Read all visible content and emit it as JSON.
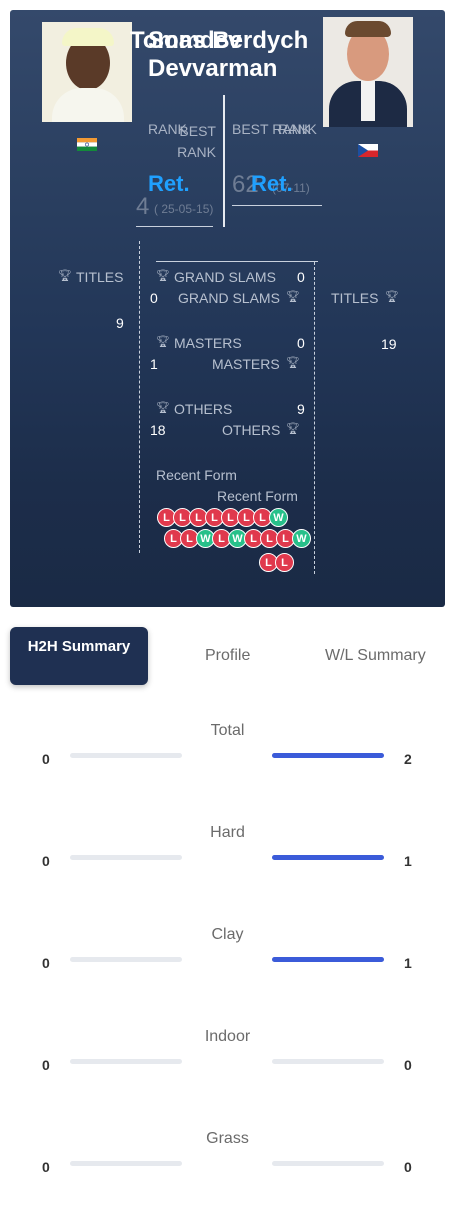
{
  "player1": {
    "name": "Somdev Devvarman",
    "country_flag": "india-flag-icon",
    "rank_label": "RANK",
    "rank_value": "Ret.",
    "best_rank_label": "BEST RANK",
    "best_rank_value": "4",
    "best_rank_date": "( 25-05-15)",
    "titles_label": "TITLES",
    "titles_value": "9",
    "grand_slams_label": "GRAND SLAMS",
    "grand_slams_value": "0",
    "masters_label": "MASTERS",
    "masters_value": "1",
    "others_label": "OTHERS",
    "others_value": "18",
    "recent_form_label": "Recent Form",
    "recent_form": [
      "L",
      "L",
      "L",
      "L",
      "L",
      "L",
      "L",
      "W"
    ]
  },
  "player2": {
    "name": "Tomas Berdych",
    "country_flag": "czech-flag-icon",
    "rank_label": "RANK",
    "rank_value": "Ret.",
    "best_rank_label": "BEST RANK",
    "best_rank_value": "62",
    "best_rank_date": "(07-11)",
    "titles_label": "TITLES",
    "titles_value": "19",
    "grand_slams_label": "GRAND SLAMS",
    "grand_slams_value": "0",
    "masters_label": "MASTERS",
    "masters_value": "0",
    "others_label": "OTHERS",
    "others_value": "9",
    "recent_form_label": "Recent Form",
    "recent_form": [
      "L",
      "L",
      "W",
      "L",
      "W",
      "L",
      "L",
      "L",
      "W",
      "L",
      "L"
    ]
  },
  "tabs": {
    "h2h": "H2H Summary",
    "profile": "Profile",
    "wl": "W/L Summary"
  },
  "h2h": [
    {
      "label": "Total",
      "p1": "0",
      "p2": "2",
      "p1_share": 0,
      "p2_share": 1
    },
    {
      "label": "Hard",
      "p1": "0",
      "p2": "1",
      "p1_share": 0,
      "p2_share": 1
    },
    {
      "label": "Clay",
      "p1": "0",
      "p2": "1",
      "p1_share": 0,
      "p2_share": 1
    },
    {
      "label": "Indoor",
      "p1": "0",
      "p2": "0",
      "p1_share": 0,
      "p2_share": 0
    },
    {
      "label": "Grass",
      "p1": "0",
      "p2": "0",
      "p1_share": 0,
      "p2_share": 0
    }
  ],
  "colors": {
    "accent": "#1fa0ff",
    "loss": "#e0394d",
    "win": "#27c08a",
    "bar": "#3b5bd9"
  }
}
